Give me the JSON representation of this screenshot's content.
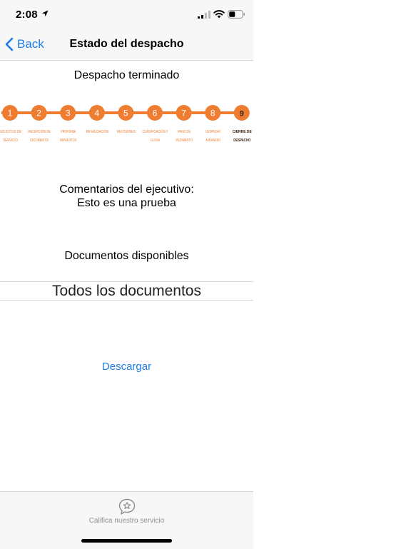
{
  "status_bar": {
    "time": "2:08"
  },
  "nav": {
    "back_label": "Back",
    "title": "Estado del despacho"
  },
  "status_text": "Despacho terminado",
  "progress": {
    "accent_color": "#ee7d31",
    "active_text_color": "#3a2210",
    "steps": [
      {
        "number": "1",
        "label_line1": "SOLICITUD DE",
        "label_line2": "SERVICIO"
      },
      {
        "number": "2",
        "label_line1": "RECEPCIÓN DE",
        "label_line2": "DOCUMENTOS"
      },
      {
        "number": "3",
        "label_line1": "PROFORMA",
        "label_line2": "IMPUESTOS"
      },
      {
        "number": "4",
        "label_line1": "REVALIDACIÓN",
        "label_line2": ""
      },
      {
        "number": "5",
        "label_line1": "REVISIONES",
        "label_line2": ""
      },
      {
        "number": "6",
        "label_line1": "CLASIFICACIÓN Y",
        "label_line2": "GLOSA"
      },
      {
        "number": "7",
        "label_line1": "PAGO DE",
        "label_line2": "PEDIMENTO"
      },
      {
        "number": "8",
        "label_line1": "DESPACHO",
        "label_line2": "ADUANERO"
      },
      {
        "number": "9",
        "label_line1": "CIERRE DE",
        "label_line2": "DESPACHO",
        "active": true
      }
    ]
  },
  "comments": {
    "label": "Comentarios del ejecutivo:",
    "text": "Esto es una prueba"
  },
  "documents": {
    "title": "Documentos disponibles",
    "selected": "Todos los documentos"
  },
  "download_label": "Descargar",
  "tabbar": {
    "item_label": "Califica nuestro servicio",
    "icon": "star-bubble-icon"
  },
  "colors": {
    "link": "#1a7ee6",
    "bar_bg": "#f7f7f7",
    "separator": "#d6d6d8"
  }
}
